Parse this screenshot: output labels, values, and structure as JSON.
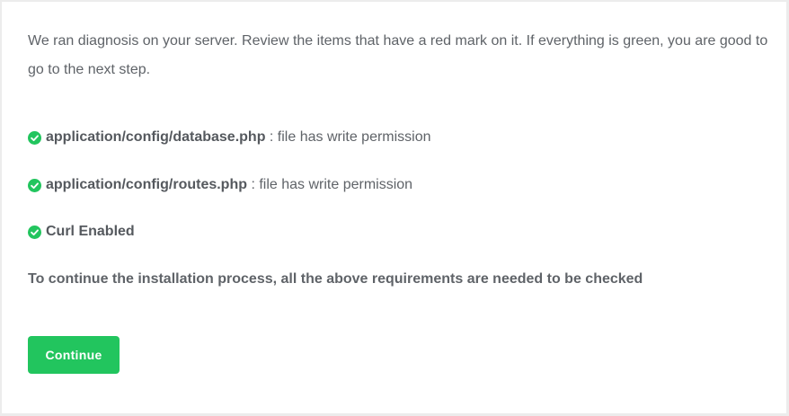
{
  "intro": {
    "text": "We ran diagnosis on your server. Review the items that have a red mark on it. If everything is green, you are good to go to the next step."
  },
  "checks": [
    {
      "icon": "check-circle-icon",
      "status": "ok",
      "name": "application/config/database.php",
      "description": " : file has write permission"
    },
    {
      "icon": "check-circle-icon",
      "status": "ok",
      "name": "application/config/routes.php",
      "description": " : file has write permission"
    },
    {
      "icon": "check-circle-icon",
      "status": "ok",
      "name": "Curl Enabled",
      "description": ""
    }
  ],
  "note": {
    "text": "To continue the installation process, all the above requirements are needed to be checked"
  },
  "continue_button": {
    "label": "Continue"
  },
  "colors": {
    "success": "#22c55e",
    "text": "#5f6368",
    "background": "#ffffff"
  }
}
